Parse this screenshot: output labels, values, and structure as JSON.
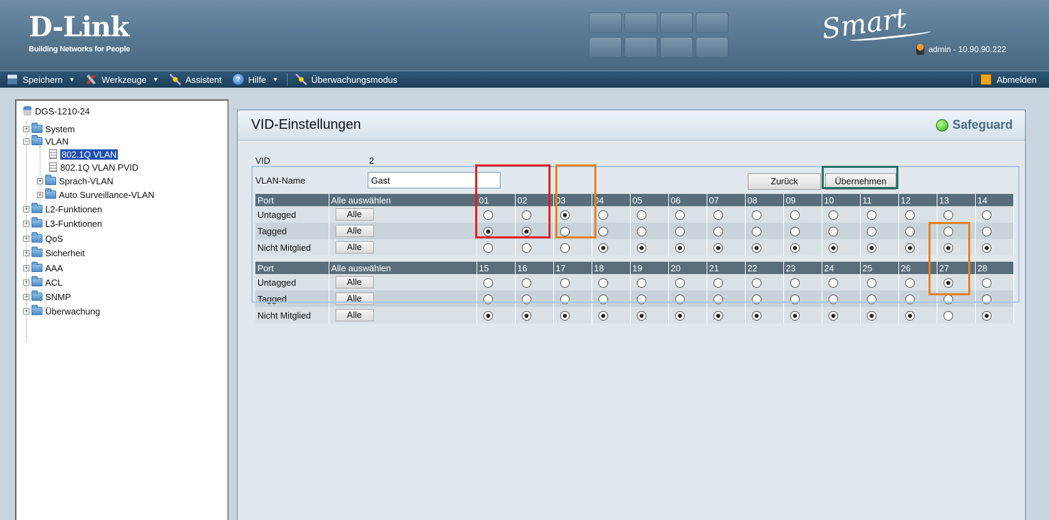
{
  "header": {
    "logo_main": "D-Link",
    "logo_sub": "Building Networks for People",
    "product_mark": "Smart",
    "user_info": "admin - 10.90.90.222"
  },
  "toolbar": {
    "save": "Speichern",
    "tools": "Werkzeuge",
    "wizard": "Assistent",
    "help": "Hilfe",
    "monitor": "Überwachungsmodus",
    "logout": "Abmelden"
  },
  "sidebar": {
    "device": "DGS-1210-24",
    "items": [
      {
        "label": "System"
      },
      {
        "label": "VLAN"
      },
      {
        "label": "802.1Q VLAN"
      },
      {
        "label": "802.1Q VLAN PVID"
      },
      {
        "label": "Sprach-VLAN"
      },
      {
        "label": "Auto Surveillance-VLAN"
      },
      {
        "label": "L2-Funktionen"
      },
      {
        "label": "L3-Funktionen"
      },
      {
        "label": "QoS"
      },
      {
        "label": "Sicherheit"
      },
      {
        "label": "AAA"
      },
      {
        "label": "ACL"
      },
      {
        "label": "SNMP"
      },
      {
        "label": "Überwachung"
      }
    ]
  },
  "panel": {
    "title": "VID-Einstellungen",
    "safeguard": "Safeguard",
    "vid_label": "VID",
    "vid_value": "2",
    "name_label": "VLAN-Name",
    "name_value": "Gast",
    "back_button": "Zurück",
    "apply_button": "Übernehmen",
    "port_header": "Port",
    "select_all_header": "Alle auswählen",
    "row_labels": [
      "Untagged",
      "Tagged",
      "Nicht Mitglied"
    ],
    "all_button": "Alle",
    "ports_block1": [
      "01",
      "02",
      "03",
      "04",
      "05",
      "06",
      "07",
      "08",
      "09",
      "10",
      "11",
      "12",
      "13",
      "14"
    ],
    "ports_block2": [
      "15",
      "16",
      "17",
      "18",
      "19",
      "20",
      "21",
      "22",
      "23",
      "24",
      "25",
      "26",
      "27",
      "28"
    ],
    "membership_block1": [
      "T",
      "T",
      "U",
      "N",
      "N",
      "N",
      "N",
      "N",
      "N",
      "N",
      "N",
      "N",
      "N",
      "N"
    ],
    "membership_block2": [
      "N",
      "N",
      "N",
      "N",
      "N",
      "N",
      "N",
      "N",
      "N",
      "N",
      "N",
      "N",
      "U",
      "N"
    ]
  },
  "highlights": {
    "red": "#e0201c",
    "orange": "#e8821e",
    "teal": "#1f6f66",
    "light_blue": "#a9c6ec"
  }
}
